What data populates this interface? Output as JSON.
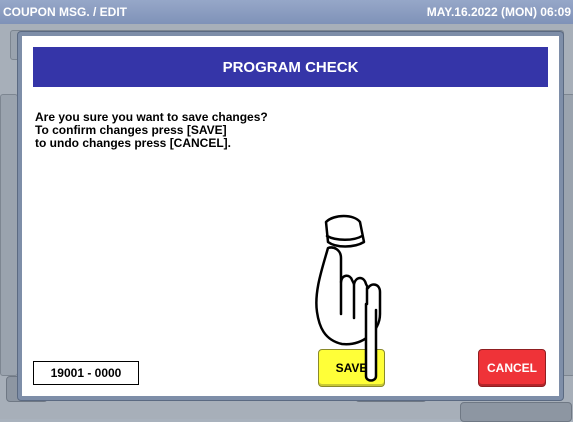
{
  "header": {
    "title": "COUPON MSG. / EDIT",
    "datetime": "MAY.16.2022 (MON) 06:09"
  },
  "dialog": {
    "title": "PROGRAM CHECK",
    "message_lines": [
      "Are you sure you want to save changes?",
      "To confirm changes press [SAVE]",
      "to undo changes press [CANCEL]."
    ],
    "code": "19001 - 0000",
    "save_label": "SAVE",
    "cancel_label": "CANCEL"
  },
  "colors": {
    "header_blue": "#3535a8",
    "save_yellow": "#ffff38",
    "cancel_red": "#ef3338"
  },
  "icons": {
    "pointer": "pointing-hand-icon"
  }
}
